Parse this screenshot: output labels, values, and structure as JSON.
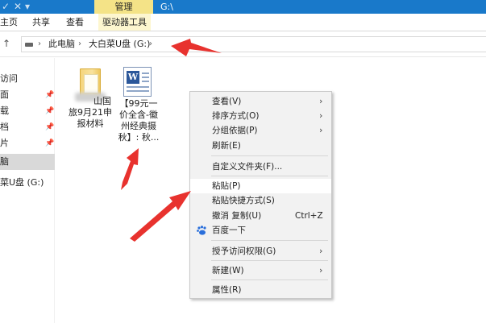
{
  "titlebar": {
    "manage_tab": "管理",
    "window_title": "G:\\",
    "qa_check": "✓",
    "qa_close": "✕",
    "qa_dropdown": "▾",
    "accent": "#1979ca",
    "context_tab_color": "#f4e387"
  },
  "ribbon": {
    "tab_home": "主页",
    "tab_share": "共享",
    "tab_view": "查看",
    "tab_drive_tools": "驱动器工具"
  },
  "address": {
    "up_arrow": "↑",
    "this_pc": "此电脑",
    "drive": "大白菜U盘 (G:)",
    "chevron": "›"
  },
  "navpane": {
    "items": [
      "访问",
      "面",
      "载",
      "档",
      "片",
      "脑",
      "菜U盘 (G:)"
    ],
    "pin_glyph": "📌"
  },
  "files": {
    "folder_label_line1": "山国",
    "folder_label_line2": "旅9月21申",
    "folder_label_line3": "报材料",
    "doc_label_line1": "【99元一",
    "doc_label_line2": "价全含-徽",
    "doc_label_line3": "州经典摄",
    "doc_label_line4": "秋】: 秋...",
    "doc_glyph": "W"
  },
  "context_menu": {
    "view": "查看(V)",
    "sort": "排序方式(O)",
    "group": "分组依据(P)",
    "refresh": "刷新(E)",
    "customize": "自定义文件夹(F)...",
    "paste": "粘贴(P)",
    "paste_shortcut": "粘贴快捷方式(S)",
    "undo_copy": "撤消 复制(U)",
    "undo_shortcut": "Ctrl+Z",
    "baidu": "百度一下",
    "grant_access": "授予访问权限(G)",
    "new": "新建(W)",
    "properties": "属性(R)",
    "submenu_arrow": "›"
  },
  "annotation_color": "#e8322e"
}
